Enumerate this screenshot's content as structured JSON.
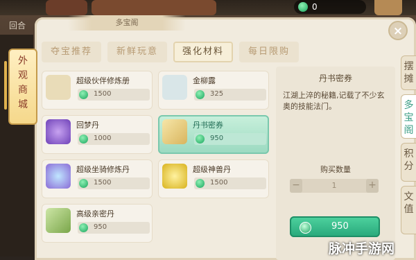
{
  "hud": {
    "round_label": "回合",
    "currency_value": "0"
  },
  "panel": {
    "title": "多宝阁",
    "close_glyph": "×"
  },
  "side_tab_left": {
    "label": "外观商城"
  },
  "side_tabs_right": [
    {
      "label": "摆摊",
      "active": false
    },
    {
      "label": "多宝阁",
      "active": true
    },
    {
      "label": "积分",
      "active": false
    },
    {
      "label": "文值",
      "active": false
    }
  ],
  "categories": [
    {
      "label": "夺宝推荐",
      "active": false
    },
    {
      "label": "新鲜玩意",
      "active": false
    },
    {
      "label": "强化材料",
      "active": true
    },
    {
      "label": "每日限购",
      "active": false
    }
  ],
  "items": [
    {
      "name": "超级伙伴修炼册",
      "price": "1500",
      "selected": false,
      "icon": "scroll-book-icon"
    },
    {
      "name": "金柳露",
      "price": "325",
      "selected": false,
      "icon": "potion-vase-icon"
    },
    {
      "name": "回梦丹",
      "price": "1000",
      "selected": false,
      "icon": "purple-orb-icon"
    },
    {
      "name": "丹书密券",
      "price": "950",
      "selected": true,
      "icon": "paper-scroll-icon"
    },
    {
      "name": "超级坐骑修炼丹",
      "price": "1500",
      "selected": false,
      "icon": "crystal-pill-icon"
    },
    {
      "name": "超级神兽丹",
      "price": "1500",
      "selected": false,
      "icon": "golden-fruit-icon"
    },
    {
      "name": "高级亲密丹",
      "price": "950",
      "selected": false,
      "icon": "green-box-icon"
    }
  ],
  "detail": {
    "title": "丹书密券",
    "description": "江湖上淬的秘籍,记载了不少玄奥的技能法门。",
    "quantity_label": "购买数量",
    "quantity_value": "1",
    "minus_glyph": "−",
    "plus_glyph": "+",
    "buy_price": "950"
  },
  "watermark": "脉冲手游网",
  "colors": {
    "accent_green": "#27a77a",
    "panel_bg": "#f1ebde",
    "selected_item": "#9ad9c0"
  }
}
